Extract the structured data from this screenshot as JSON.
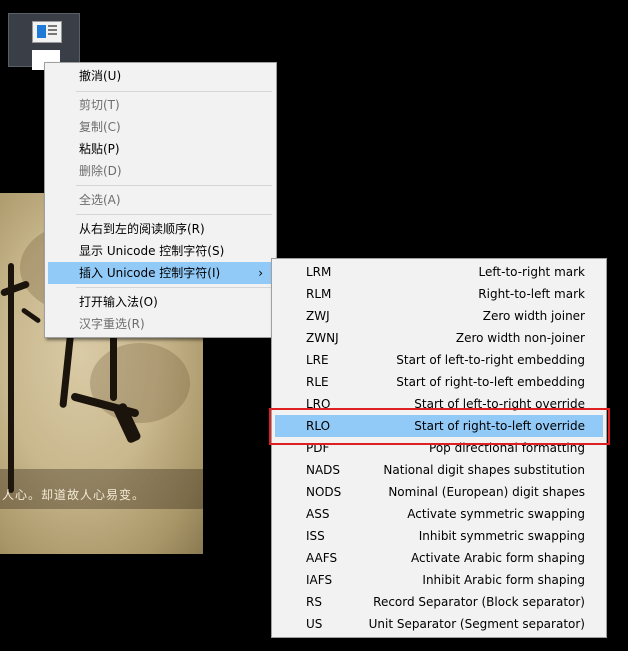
{
  "main_menu": {
    "items": [
      {
        "label": "撤消(U)",
        "disabled": false
      },
      {
        "label": "剪切(T)",
        "disabled": true
      },
      {
        "label": "复制(C)",
        "disabled": true
      },
      {
        "label": "粘贴(P)",
        "disabled": false
      },
      {
        "label": "删除(D)",
        "disabled": true
      },
      {
        "label": "全选(A)",
        "disabled": true
      },
      {
        "label": "从右到左的阅读顺序(R)",
        "disabled": false
      },
      {
        "label": "显示 Unicode 控制字符(S)",
        "disabled": false
      },
      {
        "label": "插入 Unicode 控制字符(I)",
        "disabled": false,
        "has_submenu": true
      },
      {
        "label": "打开输入法(O)",
        "disabled": false
      },
      {
        "label": "汉字重选(R)",
        "disabled": true
      }
    ],
    "arrow": "›"
  },
  "sub_menu": {
    "items": [
      {
        "code": "LRM",
        "desc": "Left-to-right mark"
      },
      {
        "code": "RLM",
        "desc": "Right-to-left mark"
      },
      {
        "code": "ZWJ",
        "desc": "Zero width joiner"
      },
      {
        "code": "ZWNJ",
        "desc": "Zero width non-joiner"
      },
      {
        "code": "LRE",
        "desc": "Start of left-to-right embedding"
      },
      {
        "code": "RLE",
        "desc": "Start of right-to-left embedding"
      },
      {
        "code": "LRO",
        "desc": "Start of left-to-right override"
      },
      {
        "code": "RLO",
        "desc": "Start of right-to-left override"
      },
      {
        "code": "PDF",
        "desc": "Pop directional formatting"
      },
      {
        "code": "NADS",
        "desc": "National digit shapes substitution"
      },
      {
        "code": "NODS",
        "desc": "Nominal (European) digit shapes"
      },
      {
        "code": "ASS",
        "desc": "Activate symmetric swapping"
      },
      {
        "code": "ISS",
        "desc": "Inhibit symmetric swapping"
      },
      {
        "code": "AAFS",
        "desc": "Activate Arabic form shaping"
      },
      {
        "code": "IAFS",
        "desc": "Inhibit Arabic form shaping"
      },
      {
        "code": "RS",
        "desc": "Record Separator (Block separator)"
      },
      {
        "code": "US",
        "desc": "Unit Separator (Segment separator)"
      }
    ],
    "highlighted_code": "RLO"
  },
  "background": {
    "caption": "人心。却道故人心易变。"
  },
  "colors": {
    "menu_bg": "#f2f2f2",
    "hover_bg": "#91c9f7",
    "annotation_red": "#e02020"
  }
}
